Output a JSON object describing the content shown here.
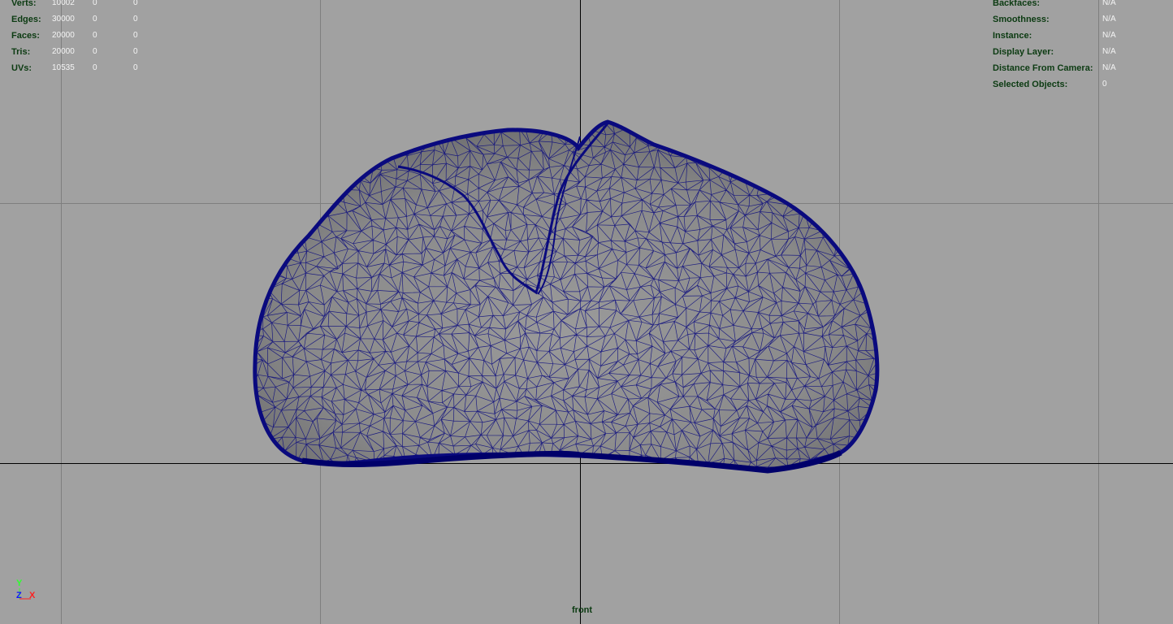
{
  "viewport": {
    "camera_name": "front",
    "background_color": "#a1a1a1",
    "grid_line_color": "#7f7f7f",
    "origin_axis_color": "#000000",
    "wireframe_color": "#0a0a7e",
    "mesh_fill_color": "#8e8e8e"
  },
  "heads_up_display": {
    "poly_count": [
      {
        "label": "Verts:",
        "total": "10002",
        "selected": "0",
        "highlighted": "0"
      },
      {
        "label": "Edges:",
        "total": "30000",
        "selected": "0",
        "highlighted": "0"
      },
      {
        "label": "Faces:",
        "total": "20000",
        "selected": "0",
        "highlighted": "0"
      },
      {
        "label": "Tris:",
        "total": "20000",
        "selected": "0",
        "highlighted": "0"
      },
      {
        "label": "UVs:",
        "total": "10535",
        "selected": "0",
        "highlighted": "0"
      }
    ],
    "object_details": [
      {
        "label": "Backfaces:",
        "value": "N/A"
      },
      {
        "label": "Smoothness:",
        "value": "N/A"
      },
      {
        "label": "Instance:",
        "value": "N/A"
      },
      {
        "label": "Display Layer:",
        "value": "N/A"
      },
      {
        "label": "Distance From Camera:",
        "value": "N/A"
      },
      {
        "label": "Selected Objects:",
        "value": "0"
      }
    ]
  },
  "view_axis": {
    "y_label": "Y",
    "z_label": "Z",
    "x_label": "X",
    "y_color": "#2dff2d",
    "z_color": "#1414ff",
    "x_color": "#ff1f1f"
  }
}
